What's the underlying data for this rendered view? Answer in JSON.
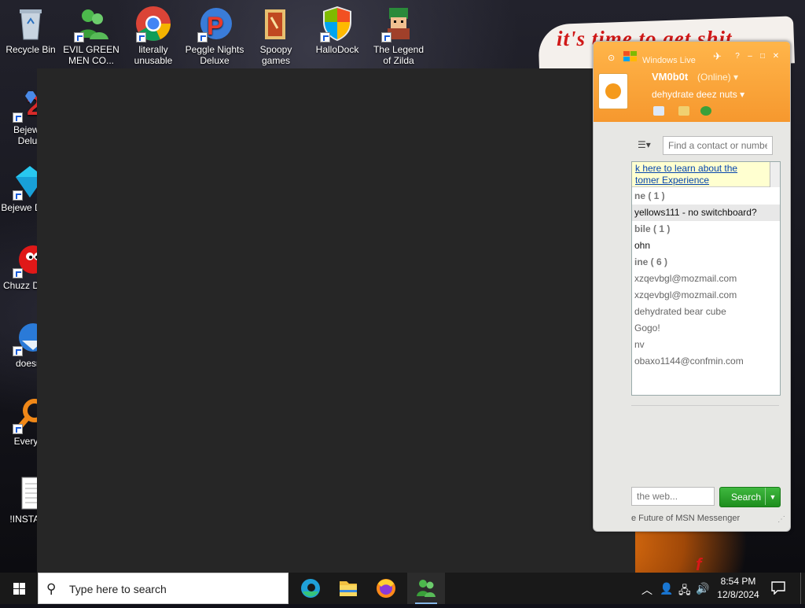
{
  "desktop": {
    "icons": [
      {
        "label": "Recycle Bin"
      },
      {
        "label": "EVIL GREEN MEN CO..."
      },
      {
        "label": "literally unusable"
      },
      {
        "label": "Peggle Nights Deluxe"
      },
      {
        "label": "Spoopy games"
      },
      {
        "label": "HalloDock"
      },
      {
        "label": "The Legend of Zilda"
      },
      {
        "label": "Bejewel Delux"
      },
      {
        "label": "Bejewe Delux"
      },
      {
        "label": "Chuzz Delux"
      },
      {
        "label": "doesnt"
      },
      {
        "label": "Everyth"
      },
      {
        "label": "!INSTALL"
      }
    ],
    "wallpaper_banner": "it's time to get shit",
    "wallpaper_bottom_text": "f"
  },
  "msn": {
    "title": "Windows Live",
    "display_name": "VM0b0t",
    "status": "(Online)",
    "personal_message": "dehydrate deez nuts",
    "find_placeholder": "Find a contact or number",
    "ad_line1": "k here to learn about the",
    "ad_line2": "tomer Experience",
    "groups": [
      {
        "label": "ne ( 1 )",
        "type": "group"
      },
      {
        "label": "yellows111 - no switchboard?",
        "type": "online",
        "selected": true
      },
      {
        "label": "bile ( 1 )",
        "type": "group"
      },
      {
        "label": "ohn",
        "type": "online"
      },
      {
        "label": "ine ( 6 )",
        "type": "group"
      },
      {
        "label": "xzqevbgl@mozmail.com",
        "type": "offline"
      },
      {
        "label": "xzqevbgl@mozmail.com",
        "type": "offline"
      },
      {
        "label": "dehydrated bear cube",
        "type": "offline"
      },
      {
        "label": "Gogo!",
        "type": "offline"
      },
      {
        "label": "nv",
        "type": "offline"
      },
      {
        "label": "obaxo1144@confmin.com",
        "type": "offline"
      }
    ],
    "web_search_placeholder": "the web...",
    "search_button": "Search",
    "footer": "e Future of MSN Messenger"
  },
  "taskbar": {
    "search_placeholder": "Type here to search",
    "time": "8:54 PM",
    "date": "12/8/2024"
  },
  "colors": {
    "msn_orange": "#f6982e",
    "search_green": "#2aa52a",
    "taskbar": "#191919"
  }
}
